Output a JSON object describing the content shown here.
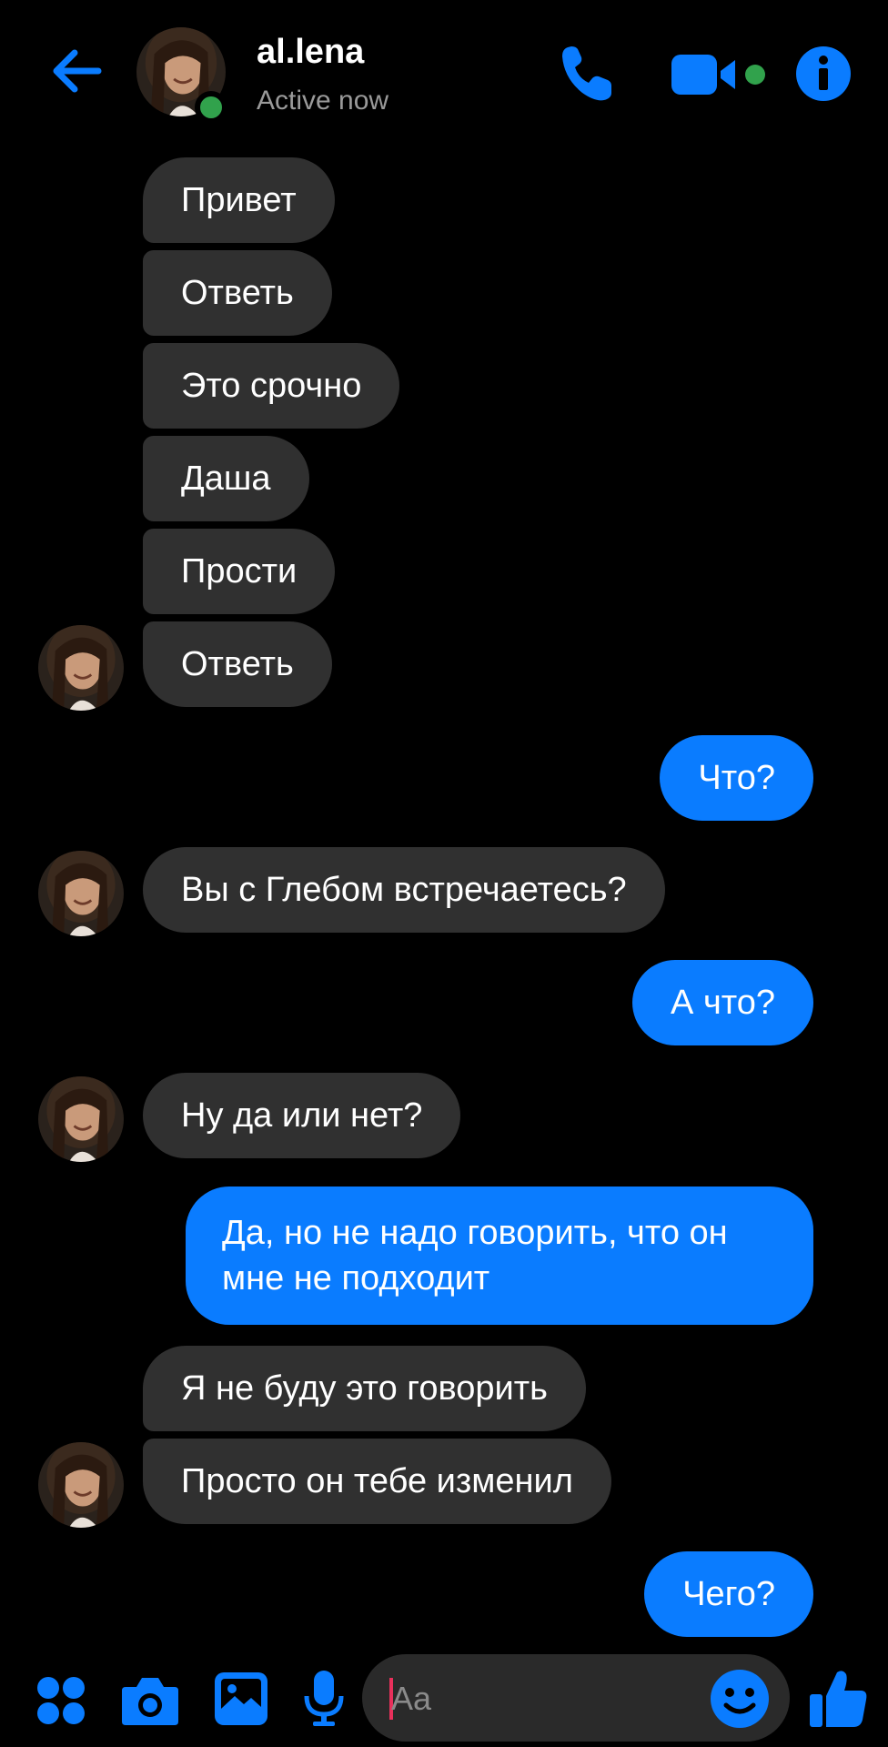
{
  "header": {
    "name": "al.lena",
    "status": "Active now"
  },
  "messages": [
    {
      "dir": "in",
      "text": "Привет"
    },
    {
      "dir": "in",
      "text": "Ответь"
    },
    {
      "dir": "in",
      "text": "Это срочно"
    },
    {
      "dir": "in",
      "text": "Даша"
    },
    {
      "dir": "in",
      "text": "Прости"
    },
    {
      "dir": "in",
      "text": "Ответь"
    },
    {
      "dir": "out",
      "text": "Что?"
    },
    {
      "dir": "in",
      "text": "Вы с Глебом встречаетесь?"
    },
    {
      "dir": "out",
      "text": "А что?"
    },
    {
      "dir": "in",
      "text": "Ну да или нет?"
    },
    {
      "dir": "out",
      "text": "Да, но не надо говорить, что он мне не подходит"
    },
    {
      "dir": "in",
      "text": "Я не буду это говорить"
    },
    {
      "dir": "in",
      "text": "Просто он тебе изменил"
    },
    {
      "dir": "out",
      "text": "Чего?"
    }
  ],
  "composer": {
    "placeholder": "Aa"
  },
  "icons": {
    "back": "arrow-left-icon",
    "call": "phone-icon",
    "video": "video-camera-icon",
    "info": "info-icon",
    "apps": "four-dots-icon",
    "camera": "camera-icon",
    "gallery": "image-icon",
    "mic": "microphone-icon",
    "emoji": "smiley-icon",
    "like": "thumbs-up-icon"
  },
  "colors": {
    "accent": "#0a7cff",
    "incoming_bubble": "#303030",
    "online": "#31a24c",
    "cursor": "#e8305b"
  }
}
